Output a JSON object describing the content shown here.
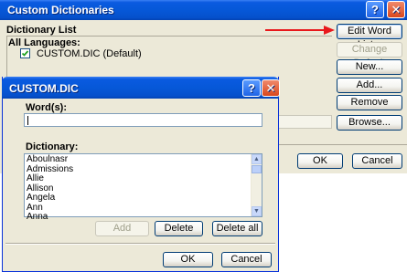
{
  "outer_dialog": {
    "title": "Custom Dictionaries",
    "help_label": "?",
    "close_label": "✕",
    "list_label": "Dictionary List",
    "all_languages_label": "All Languages:",
    "dictionary_entry": "CUSTOM.DIC (Default)",
    "dictionary_checked": true,
    "buttons": {
      "edit_word_list": "Edit Word List...",
      "change_default": "Change Default",
      "new": "New...",
      "add": "Add...",
      "remove": "Remove",
      "browse": "Browse...",
      "ok": "OK",
      "cancel": "Cancel"
    },
    "partial_text": "f"
  },
  "inner_dialog": {
    "title": "CUSTOM.DIC",
    "help_label": "?",
    "close_label": "✕",
    "words_label": "Word(s):",
    "words_value": "",
    "dictionary_label": "Dictionary:",
    "dictionary_words": [
      "Aboulnasr",
      "Admissions",
      "Allie",
      "Allison",
      "Angela",
      "Ann",
      "Anna"
    ],
    "buttons": {
      "add": "Add",
      "delete": "Delete",
      "delete_all": "Delete all",
      "ok": "OK",
      "cancel": "Cancel"
    }
  },
  "annotation": {
    "arrow_color": "#e8181c"
  },
  "colors": {
    "title_bar_blue": "#0658d8",
    "dialog_face": "#ece9d8",
    "close_red": "#d8471d"
  }
}
